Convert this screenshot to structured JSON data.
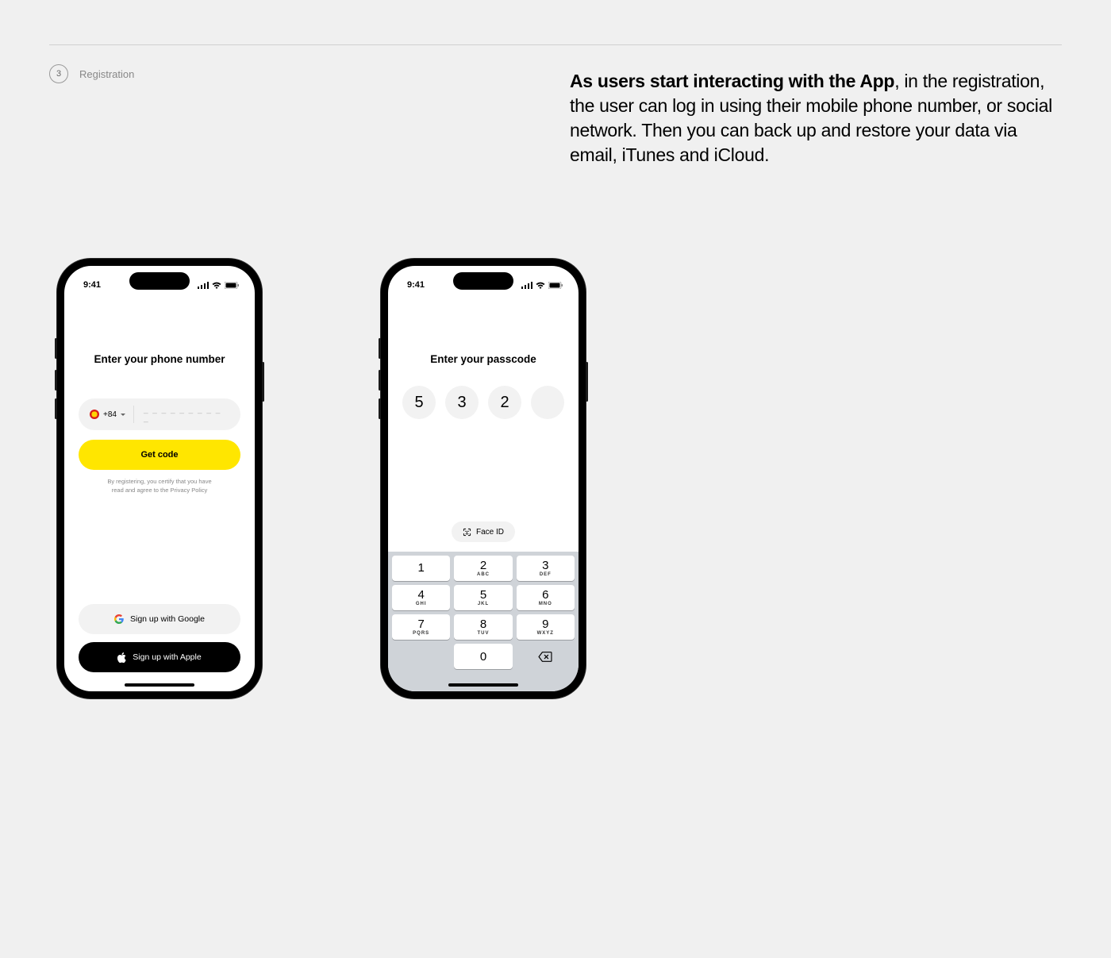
{
  "section": {
    "number": "3",
    "label": "Registration"
  },
  "description": {
    "bold": "As users start interacting with the App",
    "rest": ", in the registration, the user can log in using their mobile phone number, or social network. Then you can back up and restore your data via email, iTunes and iCloud."
  },
  "status_bar": {
    "time": "9:41"
  },
  "screen1": {
    "title": "Enter your phone number",
    "country_code": "+84",
    "phone_placeholder": "_ _ _   _ _ _    _ _ _ _",
    "get_code_label": "Get code",
    "privacy_line1": "By registering, you certify that you have",
    "privacy_line2": "read and agree to the Privacy Policy",
    "google_label": "Sign up with Google",
    "apple_label": "Sign up with Apple"
  },
  "screen2": {
    "title": "Enter your passcode",
    "pin": [
      "5",
      "3",
      "2",
      ""
    ],
    "faceid_label": "Face ID",
    "keypad": [
      {
        "num": "1",
        "sub": ""
      },
      {
        "num": "2",
        "sub": "ABC"
      },
      {
        "num": "3",
        "sub": "DEF"
      },
      {
        "num": "4",
        "sub": "GHI"
      },
      {
        "num": "5",
        "sub": "JKL"
      },
      {
        "num": "6",
        "sub": "MNO"
      },
      {
        "num": "7",
        "sub": "PQRS"
      },
      {
        "num": "8",
        "sub": "TUV"
      },
      {
        "num": "9",
        "sub": "WXYZ"
      },
      {
        "num": "0",
        "sub": ""
      }
    ]
  }
}
